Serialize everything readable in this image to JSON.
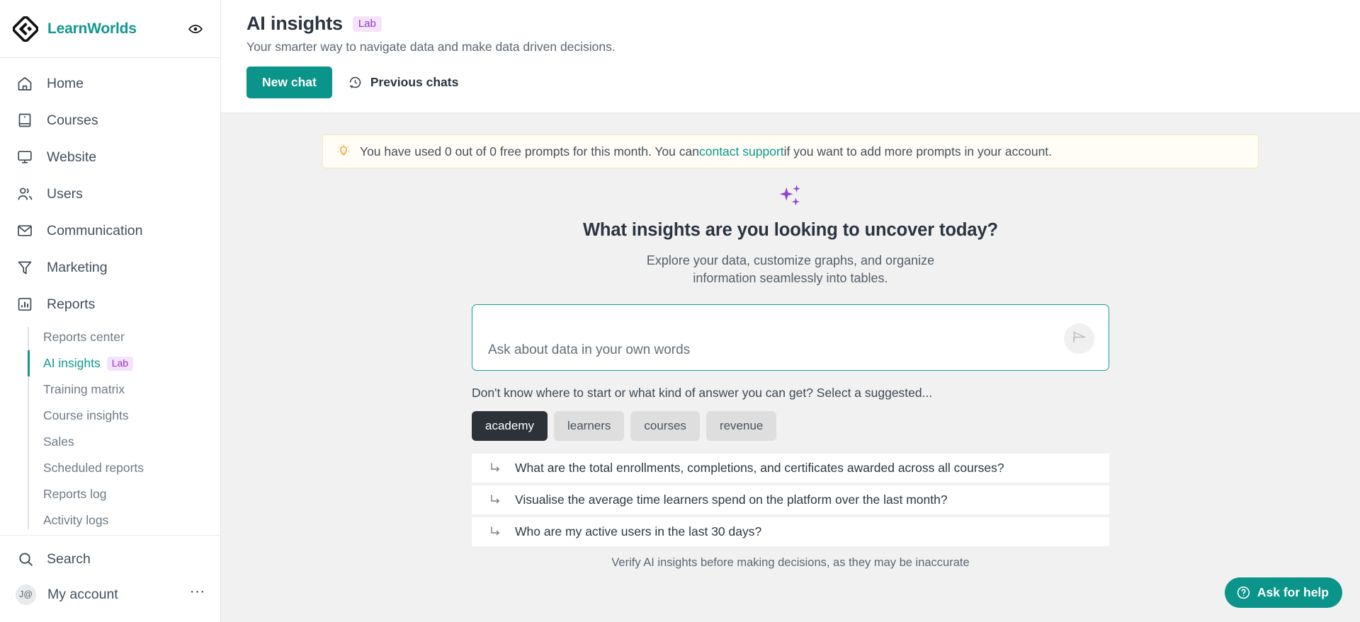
{
  "brand": {
    "name": "LearnWorlds",
    "logo_icon": "learnworlds-diamond-logo",
    "accent_color": "#10978f",
    "preview_icon": "eye-icon"
  },
  "sidebar": {
    "items": [
      {
        "label": "Home",
        "icon": "home-icon"
      },
      {
        "label": "Courses",
        "icon": "book-icon"
      },
      {
        "label": "Website",
        "icon": "monitor-icon"
      },
      {
        "label": "Users",
        "icon": "users-icon"
      },
      {
        "label": "Communication",
        "icon": "envelope-icon"
      },
      {
        "label": "Marketing",
        "icon": "funnel-icon"
      },
      {
        "label": "Reports",
        "icon": "bar-chart-icon"
      }
    ],
    "sub_items": [
      {
        "label": "Reports center",
        "active": false,
        "badge": ""
      },
      {
        "label": "AI insights",
        "active": true,
        "badge": "Lab"
      },
      {
        "label": "Training matrix",
        "active": false,
        "badge": ""
      },
      {
        "label": "Course insights",
        "active": false,
        "badge": ""
      },
      {
        "label": "Sales",
        "active": false,
        "badge": ""
      },
      {
        "label": "Scheduled reports",
        "active": false,
        "badge": ""
      },
      {
        "label": "Reports log",
        "active": false,
        "badge": ""
      },
      {
        "label": "Activity logs",
        "active": false,
        "badge": ""
      }
    ],
    "footer": {
      "search_label": "Search",
      "search_icon": "search-icon",
      "account_label": "My account",
      "account_avatar_text": "J@",
      "more_icon": "ellipsis-icon"
    }
  },
  "header": {
    "title": "AI insights",
    "badge": "Lab",
    "subtitle": "Your smarter way to navigate data and make data driven decisions.",
    "new_chat_label": "New chat",
    "previous_chats_label": "Previous chats",
    "previous_chats_icon": "history-clock-icon"
  },
  "notice": {
    "icon": "lightbulb-icon",
    "text_before": "You have used 0 out of 0 free prompts for this month. You can ",
    "link": "contact support",
    "text_after": " if you want to add more prompts in your account.",
    "free_prompts_used": 0,
    "free_prompts_total": 0,
    "border_color": "#f6e6c0",
    "background_color": "#fffdf5"
  },
  "hero": {
    "icon": "sparkles-icon",
    "icon_color": "#8e44d6",
    "heading": "What insights are you looking to uncover today?",
    "paragraph_line1": "Explore your data, customize graphs, and organize",
    "paragraph_line2": "information seamlessly into tables."
  },
  "composer": {
    "placeholder": "Ask about data in your own words",
    "value": "",
    "send_icon": "send-paper-plane-icon",
    "focus_border_color": "#14a098"
  },
  "suggestions": {
    "hint": "Don't know where to start or what kind of answer you can get? Select a suggested...",
    "chips": [
      {
        "label": "academy",
        "active": true
      },
      {
        "label": "learners",
        "active": false
      },
      {
        "label": "courses",
        "active": false
      },
      {
        "label": "revenue",
        "active": false
      }
    ],
    "rows": [
      {
        "icon": "arrow-branch-icon",
        "text": "What are the total enrollments, completions, and certificates awarded across all courses?"
      },
      {
        "icon": "arrow-branch-icon",
        "text": "Visualise the average time learners spend on the platform over the last month?"
      },
      {
        "icon": "arrow-branch-icon",
        "text": "Who are my active users in the last 30 days?"
      }
    ]
  },
  "footer": {
    "disclaimer": "Verify AI insights before making decisions, as they may be inaccurate"
  },
  "help_fab": {
    "label": "Ask for help",
    "icon": "question-circle-icon",
    "color": "#0b9489"
  }
}
